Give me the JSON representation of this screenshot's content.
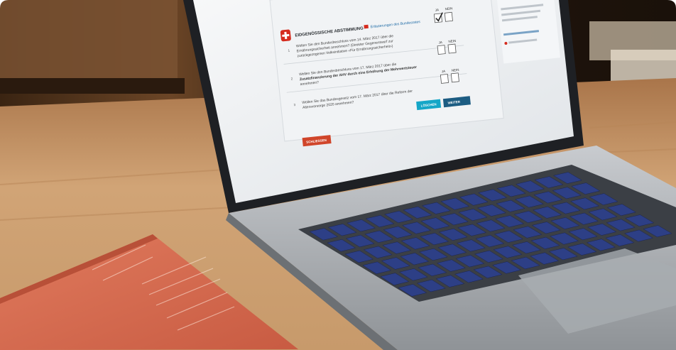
{
  "ballot": {
    "header_title": "EIDGENÖSSISCHE ABSTIMMUNG",
    "header_link": "Erläuterungen des Bundesrates",
    "col_yes": "JA",
    "col_no": "NEIN",
    "questions": [
      {
        "number": "1",
        "lines": [
          "Wollen Sie den Bundesbeschluss vom 14. März 2017 über die",
          "Ernährungssicherheit annehmen? (Direkter Gegenentwurf zur",
          "zurückgezogenen Volksinitiative «Für Ernährungssicherheit»)"
        ],
        "checked": "yes"
      },
      {
        "number": "2",
        "lines": [
          "Wollen Sie den Bundesbeschluss vom 17. März 2017 über die",
          "Zusatzfinanzierung der AHV durch eine Erhöhung der Mehrwertsteuer",
          "annehmen?"
        ],
        "checked": "none"
      },
      {
        "number": "3",
        "lines": [
          "Wollen Sie das Bundesgesetz vom 17. März 2017 über die Reform der",
          "Altersvorsorge 2020 annehmen?"
        ],
        "checked": "none"
      }
    ],
    "clear_button": "LÖSCHEN",
    "continue_button": "WEITER",
    "close_button": "SCHLIESSEN"
  },
  "colors": {
    "swiss_red": "#d52b1e",
    "teal_button": "#15a6c7",
    "navy_button": "#1c5c82",
    "orange_button": "#d0452a",
    "booklet": "#d86a4f",
    "keycaps": "#2d3f86"
  }
}
